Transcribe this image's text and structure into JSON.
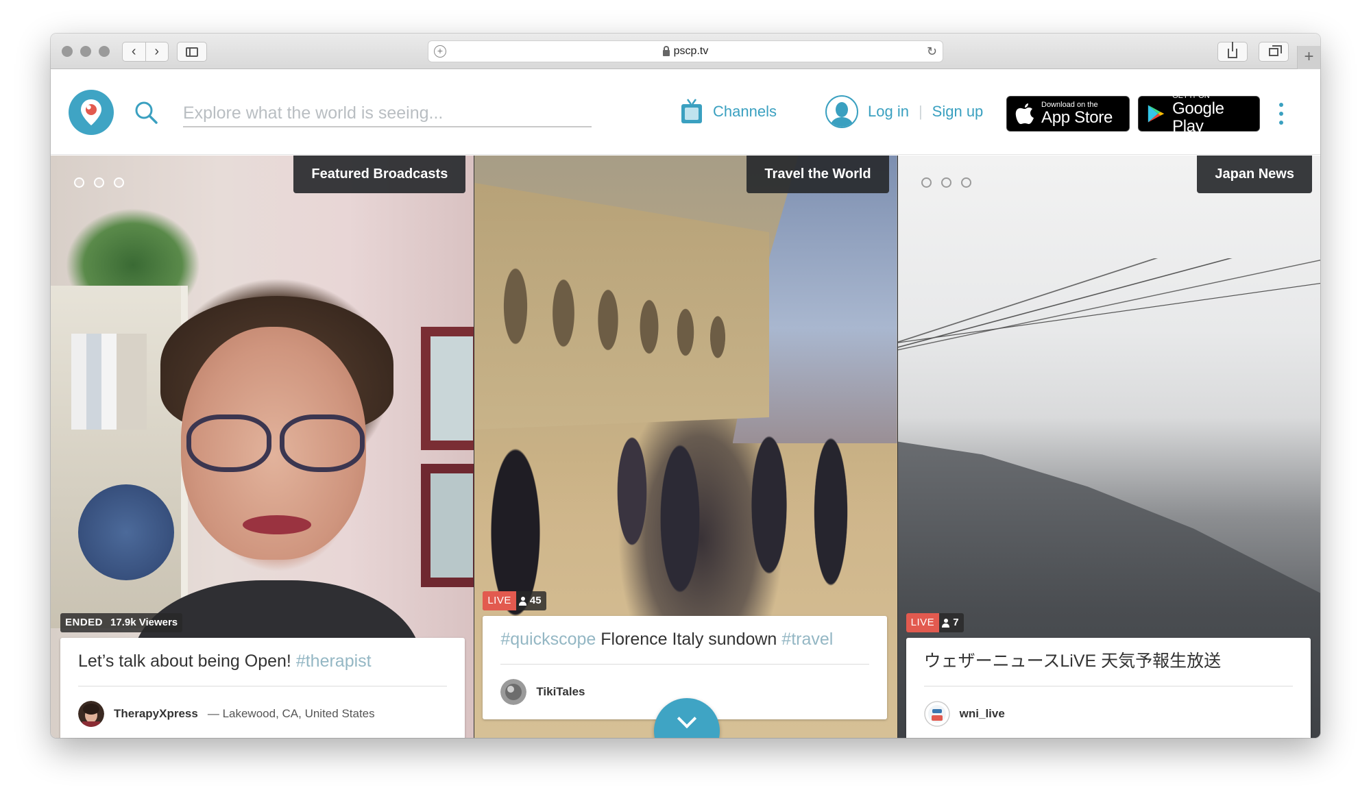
{
  "browser": {
    "url": "pscp.tv",
    "nav_back": "‹",
    "nav_forward": "›",
    "reload": "↻",
    "new_tab": "+",
    "add": "+"
  },
  "header": {
    "search_placeholder": "Explore what the world is seeing...",
    "channels_label": "Channels",
    "login_label": "Log in",
    "separator": "|",
    "signup_label": "Sign up",
    "appstore": {
      "small": "Download on the",
      "big": "App Store"
    },
    "googleplay": {
      "small": "GET IT ON",
      "big": "Google Play"
    }
  },
  "columns": [
    {
      "channel": "Featured Broadcasts",
      "status": "ENDED",
      "viewers": "17.9k Viewers",
      "title_hashtag_before": "",
      "title_text": "Let’s talk about being Open! ",
      "title_hashtag_after": "#therapist",
      "username": "TherapyXpress",
      "location": "— Lakewood, CA, United States"
    },
    {
      "channel": "Travel the World",
      "status": "LIVE",
      "viewers": "45",
      "title_hashtag_before": "#quickscope",
      "title_text": " Florence Italy sundown ",
      "title_hashtag_after": "#travel",
      "username": "TikiTales",
      "location": ""
    },
    {
      "channel": "Japan News",
      "status": "LIVE",
      "viewers": "7",
      "title_hashtag_before": "",
      "title_text": "ウェザーニュースLiVE 天気予報生放送",
      "title_hashtag_after": "",
      "username": "wni_live",
      "location": ""
    }
  ],
  "colors": {
    "accent": "#3fa4c4",
    "live": "#e25a4f"
  }
}
